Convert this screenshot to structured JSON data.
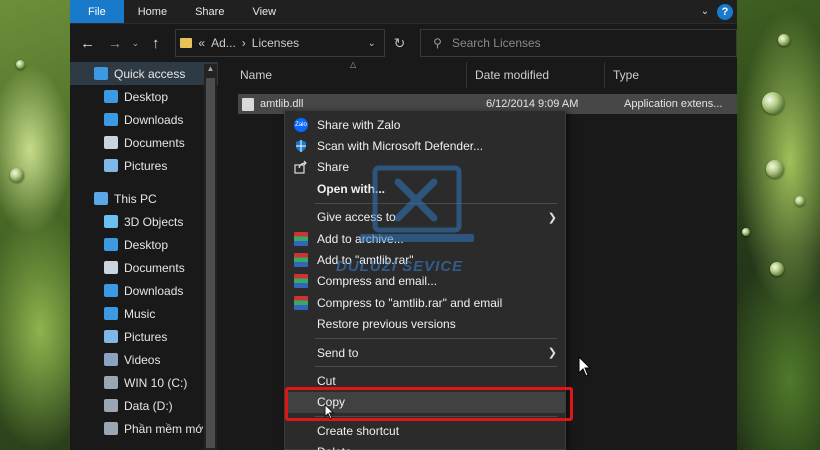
{
  "ribbon": {
    "tabs": [
      "File",
      "Home",
      "Share",
      "View"
    ],
    "help_label": "?"
  },
  "address": {
    "crumb_ellipsis": "«",
    "crumb_parent": "Ad...",
    "crumb_sep": "›",
    "crumb_current": "Licenses",
    "search_placeholder": "Search Licenses"
  },
  "nav": {
    "items": [
      {
        "label": "Quick access",
        "icon": "star-icon",
        "color": "#3b9ae1",
        "pinned": false,
        "active": true
      },
      {
        "label": "Desktop",
        "icon": "desktop-folder-icon",
        "color": "#3b9ae1",
        "pinned": true
      },
      {
        "label": "Downloads",
        "icon": "download-icon",
        "color": "#3b9ae1",
        "pinned": true
      },
      {
        "label": "Documents",
        "icon": "documents-icon",
        "color": "#c9d4df",
        "pinned": true
      },
      {
        "label": "Pictures",
        "icon": "pictures-icon",
        "color": "#7fb7e6",
        "pinned": true
      },
      {
        "label": "This PC",
        "icon": "computer-icon",
        "color": "#5aa7e8",
        "pinned": false
      },
      {
        "label": "3D Objects",
        "icon": "cube-icon",
        "color": "#6cc0f0",
        "pinned": false
      },
      {
        "label": "Desktop",
        "icon": "desktop-folder-icon",
        "color": "#3b9ae1",
        "pinned": false
      },
      {
        "label": "Documents",
        "icon": "documents-icon",
        "color": "#c9d4df",
        "pinned": false
      },
      {
        "label": "Downloads",
        "icon": "download-icon",
        "color": "#3b9ae1",
        "pinned": false
      },
      {
        "label": "Music",
        "icon": "music-icon",
        "color": "#3b9ae1",
        "pinned": false
      },
      {
        "label": "Pictures",
        "icon": "pictures-icon",
        "color": "#7fb7e6",
        "pinned": false
      },
      {
        "label": "Videos",
        "icon": "video-icon",
        "color": "#8aa3c2",
        "pinned": false
      },
      {
        "label": "WIN 10 (C:)",
        "icon": "drive-icon",
        "color": "#9aa7b3",
        "pinned": false
      },
      {
        "label": "Data (D:)",
        "icon": "drive-icon",
        "color": "#9aa7b3",
        "pinned": false
      },
      {
        "label": "Phần mềm mới I",
        "icon": "drive-icon",
        "color": "#9aa7b3",
        "pinned": false
      }
    ]
  },
  "columns": {
    "name": "Name",
    "date": "Date modified",
    "type": "Type"
  },
  "file": {
    "name": "amtlib.dll",
    "date": "6/12/2014 9:09 AM",
    "type": "Application extens..."
  },
  "menu": {
    "items": [
      {
        "label": "Share with Zalo",
        "icon": "zalo-icon"
      },
      {
        "label": "Scan with Microsoft Defender...",
        "icon": "defender-shield-icon"
      },
      {
        "label": "Share",
        "icon": "share-icon"
      },
      {
        "label": "Open with...",
        "icon": "",
        "bold": true
      },
      {
        "sep": true
      },
      {
        "label": "Give access to",
        "icon": "",
        "submenu": true
      },
      {
        "label": "Add to archive...",
        "icon": "winrar-icon"
      },
      {
        "label": "Add to \"amtlib.rar\"",
        "icon": "winrar-icon"
      },
      {
        "label": "Compress and email...",
        "icon": "winrar-icon"
      },
      {
        "label": "Compress to \"amtlib.rar\" and email",
        "icon": "winrar-icon"
      },
      {
        "label": "Restore previous versions",
        "icon": ""
      },
      {
        "sep": true
      },
      {
        "label": "Send to",
        "icon": "",
        "submenu": true
      },
      {
        "sep": true
      },
      {
        "label": "Cut",
        "icon": ""
      },
      {
        "label": "Copy",
        "icon": "",
        "hover": true
      },
      {
        "sep": true
      },
      {
        "label": "Create shortcut",
        "icon": ""
      },
      {
        "label": "Delete",
        "icon": ""
      }
    ]
  },
  "watermark": {
    "text": "DULUZI SEVICE"
  },
  "colors": {
    "accent": "#1979ca",
    "highlight": "#e01515"
  }
}
